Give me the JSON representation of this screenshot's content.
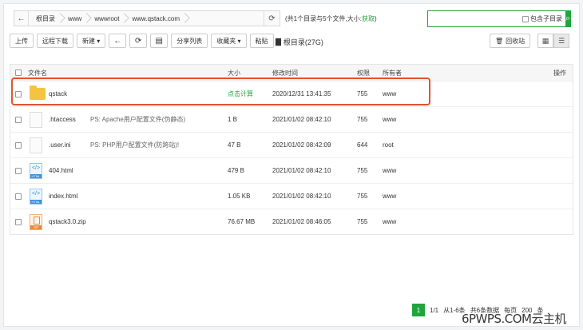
{
  "path": {
    "crumbs": [
      "根目录",
      "www",
      "wwwroot",
      "www.qstack.com"
    ],
    "summary": "(共1个目录与5个文件,大小:",
    "summary_fetch": "获取",
    "summary_end": ")"
  },
  "search": {
    "placeholder": "",
    "subdir_label": "包含子目录"
  },
  "toolbar": {
    "upload": "上传",
    "remote_download": "远程下载",
    "new": "新建",
    "share_list": "分享列表",
    "favorites": "收藏夹",
    "paste": "粘贴",
    "root_label": "根目录(27G)",
    "recycle": "回收站"
  },
  "table": {
    "headers": {
      "name": "文件名",
      "size": "大小",
      "mtime": "修改时间",
      "perm": "权限",
      "owner": "所有者",
      "ops": "操作"
    },
    "rows": [
      {
        "name": "qstack",
        "desc": "",
        "size": "点击计算",
        "mtime": "2020/12/31 13:41:35",
        "perm": "755",
        "owner": "www",
        "icon": "folder-icon"
      },
      {
        "name": ".htaccess",
        "desc": "PS: Apache用户配置文件(伪静态)",
        "size": "1 B",
        "mtime": "2021/01/02 08:42:10",
        "perm": "755",
        "owner": "www",
        "icon": "file-icon"
      },
      {
        "name": ".user.ini",
        "desc": "PS: PHP用户配置文件(防跨站)!",
        "size": "47 B",
        "mtime": "2021/01/02 08:42:09",
        "perm": "644",
        "owner": "root",
        "icon": "file-icon"
      },
      {
        "name": "404.html",
        "desc": "",
        "size": "479 B",
        "mtime": "2021/01/02 08:42:10",
        "perm": "755",
        "owner": "www",
        "icon": "html-icon"
      },
      {
        "name": "index.html",
        "desc": "",
        "size": "1.05 KB",
        "mtime": "2021/01/02 08:42:10",
        "perm": "755",
        "owner": "www",
        "icon": "html-icon"
      },
      {
        "name": "qstack3.0.zip",
        "desc": "",
        "size": "76.67 MB",
        "mtime": "2021/01/02 08:46:05",
        "perm": "755",
        "owner": "www",
        "icon": "zip-icon"
      }
    ]
  },
  "pager": {
    "current": "1",
    "range": "1/1",
    "from_to": "从1-6条",
    "total": "共6条数据",
    "per_page": "每页",
    "per_page_value": "200",
    "unit": "条"
  },
  "watermark": "6PWPS.COM云主机",
  "colors": {
    "accent": "#20a53a",
    "highlight": "#e2532e"
  }
}
